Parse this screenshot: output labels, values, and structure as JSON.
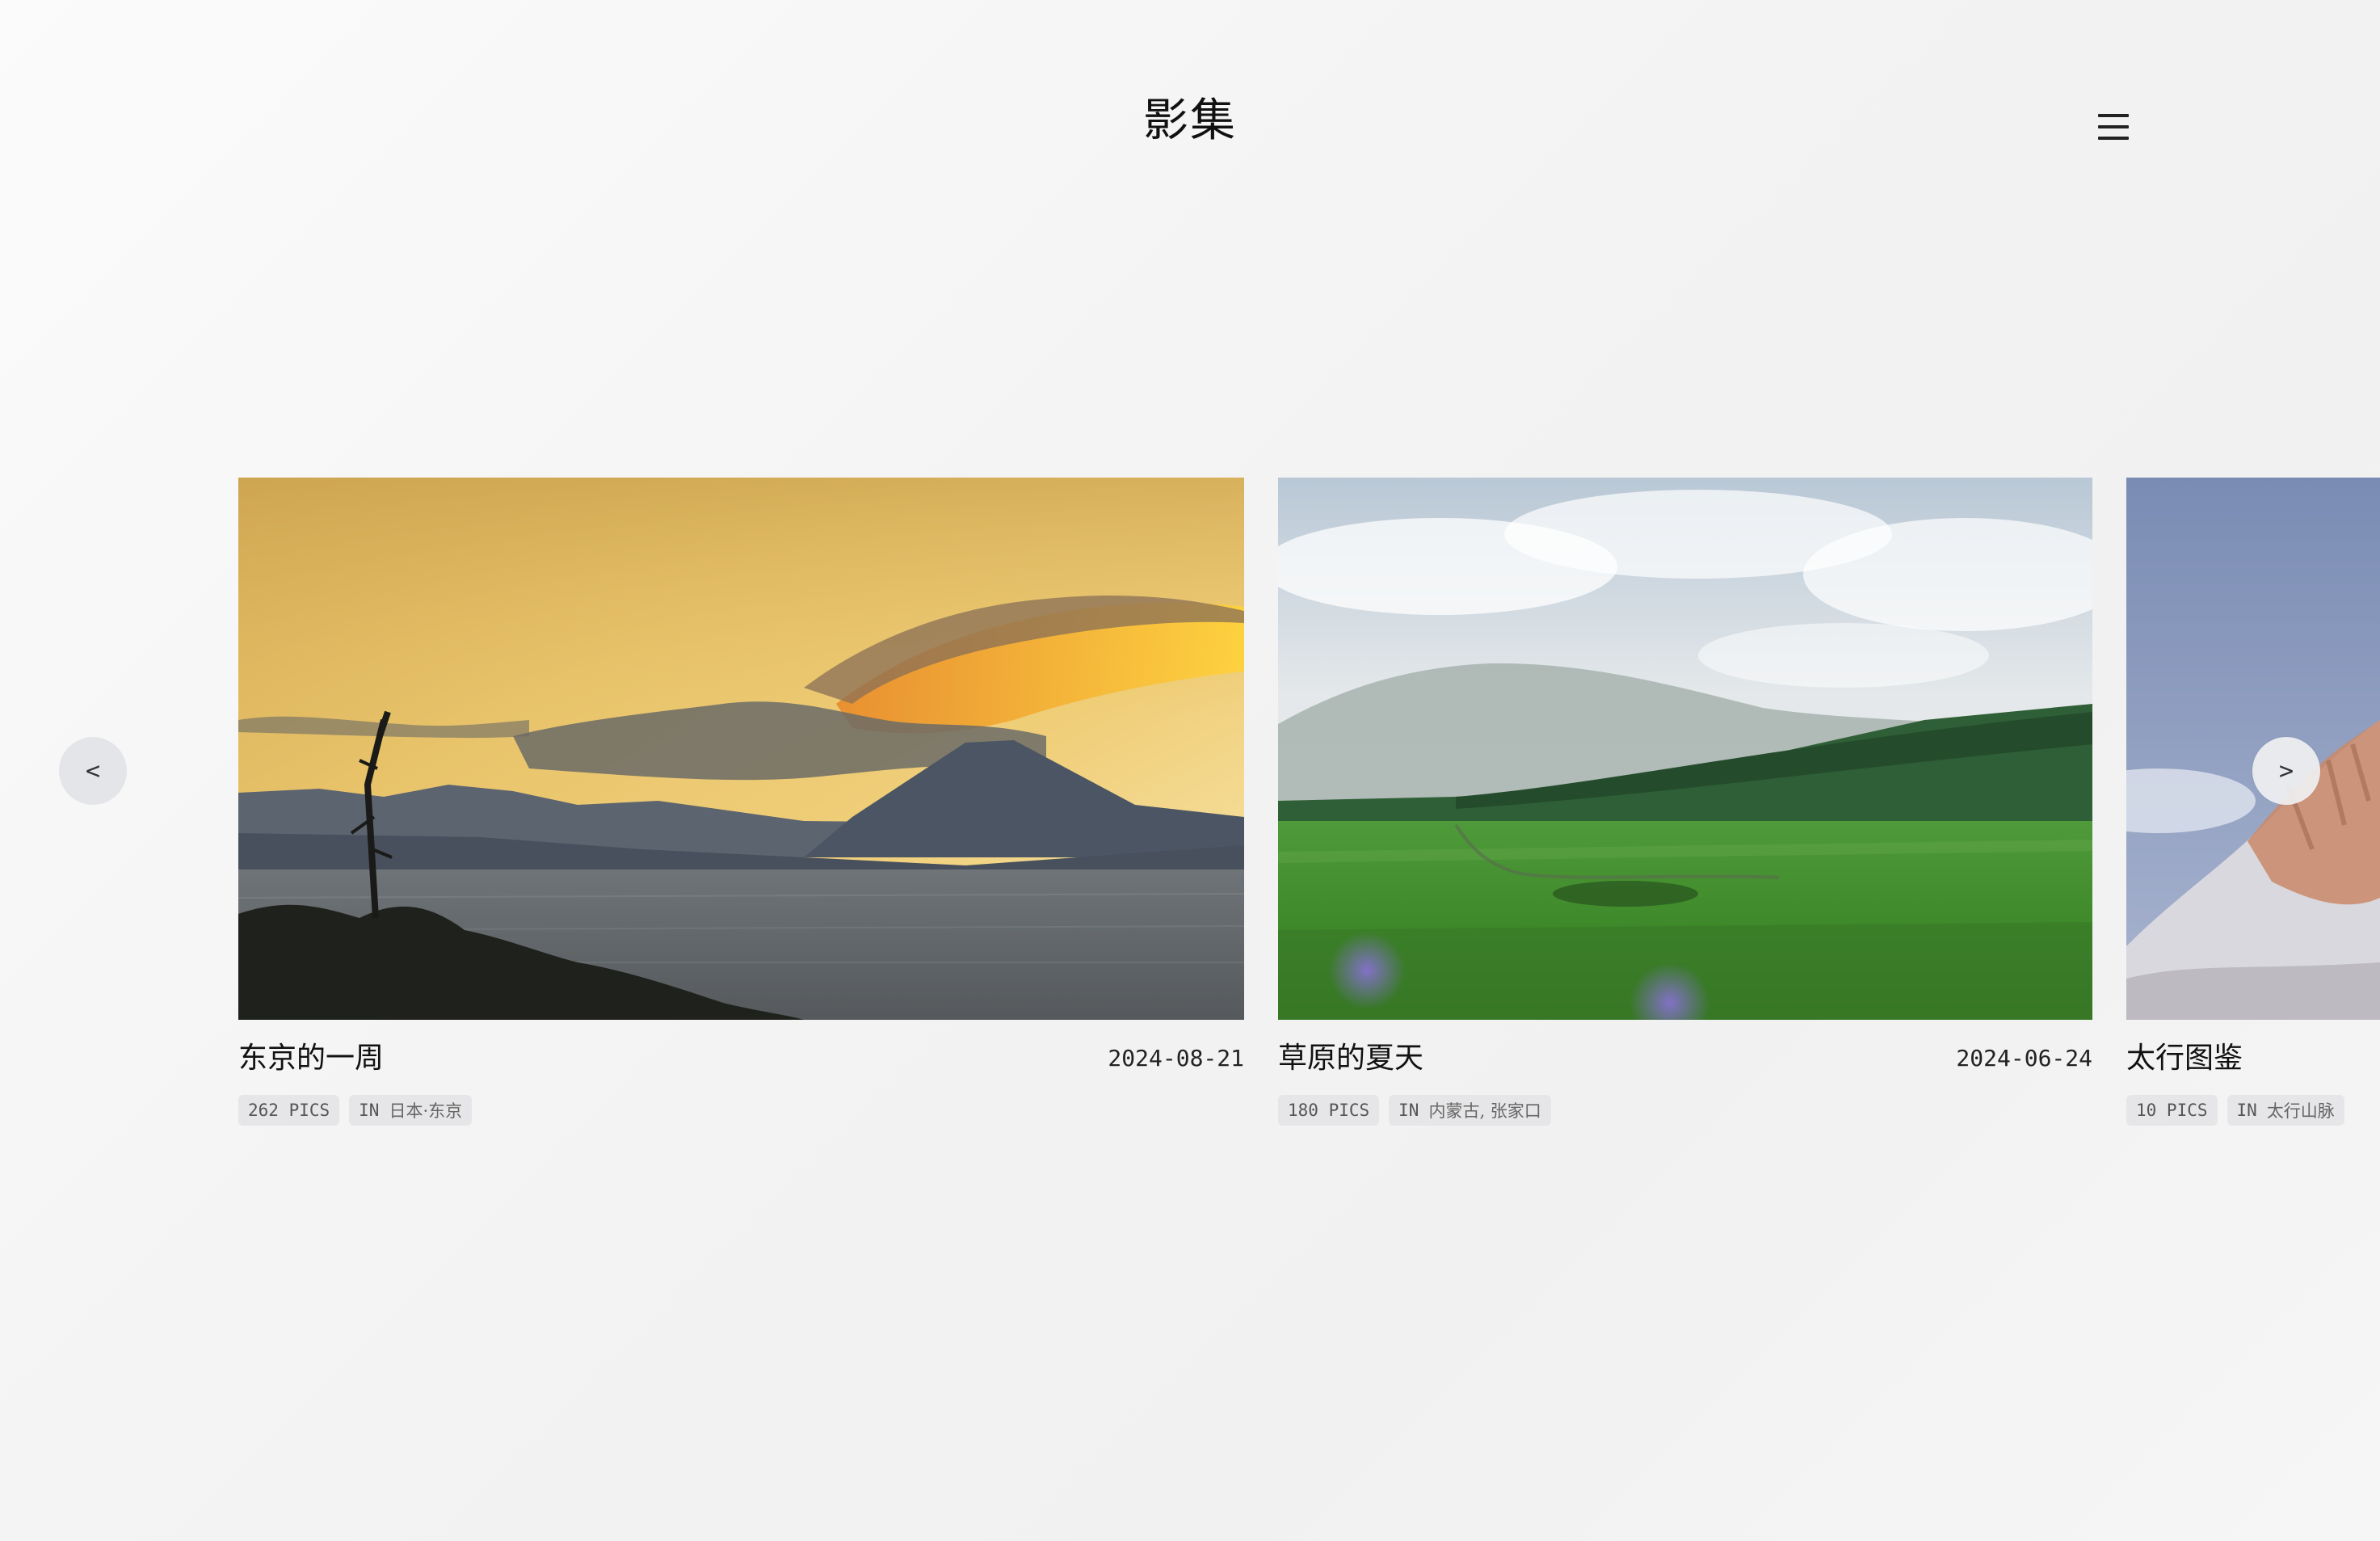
{
  "header": {
    "title": "影集",
    "menu_icon": "hamburger-menu-icon"
  },
  "carousel": {
    "prev_label": "<",
    "next_label": ">",
    "albums": [
      {
        "title": "东京的一周",
        "date": "2024-08-21",
        "pics": "262 PICS",
        "in_prefix": "IN",
        "location": "日本·东京",
        "photo": "sunset-mountain-over-sea"
      },
      {
        "title": "草原的夏天",
        "date": "2024-06-24",
        "pics": "180 PICS",
        "in_prefix": "IN",
        "location": "内蒙古, 张家口",
        "photo": "green-grassland-with-hills"
      },
      {
        "title": "太行图鉴",
        "date": "",
        "pics": "10 PICS",
        "in_prefix": "IN",
        "location": "太行山脉",
        "photo": "snowy-cliffs"
      }
    ]
  },
  "colors": {
    "background": "#f3f3f3",
    "tag_background": "#e6e6e8",
    "nav_button": "#e4e5e8",
    "text": "#111111"
  }
}
